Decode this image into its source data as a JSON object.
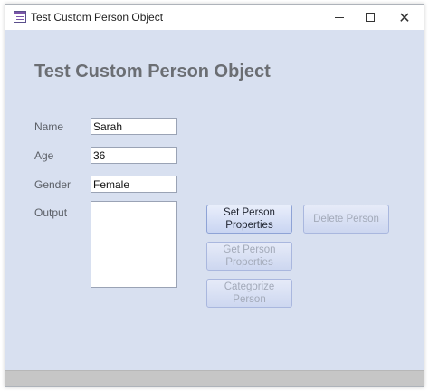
{
  "window": {
    "title": "Test Custom Person Object",
    "controls": {
      "minimize": "—",
      "maximize": "☐",
      "close": "✕"
    }
  },
  "form": {
    "heading": "Test Custom Person Object",
    "fields": {
      "name": {
        "label": "Name",
        "value": "Sarah"
      },
      "age": {
        "label": "Age",
        "value": "36"
      },
      "gender": {
        "label": "Gender",
        "value": "Female"
      },
      "output": {
        "label": "Output",
        "value": ""
      }
    },
    "buttons": {
      "set_properties": {
        "label": "Set Person Properties",
        "enabled": true
      },
      "delete_person": {
        "label": "Delete Person",
        "enabled": false
      },
      "get_properties": {
        "label": "Get Person Properties",
        "enabled": false
      },
      "categorize": {
        "label": "Categorize Person",
        "enabled": false
      }
    }
  },
  "colors": {
    "form_background": "#d8e0f0",
    "heading": "#6b6e73",
    "button_border": "#8ea3d6",
    "disabled_text": "#a3aab9"
  }
}
